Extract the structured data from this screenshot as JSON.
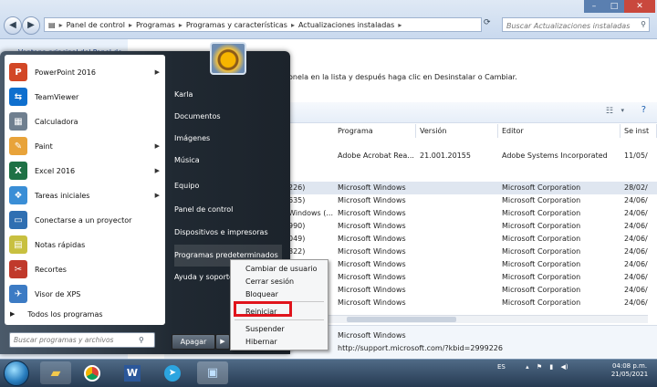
{
  "explorer": {
    "breadcrumbs": [
      "Panel de control",
      "Programas",
      "Programas y características",
      "Actualizaciones instaladas"
    ],
    "search_placeholder": "Buscar Actualizaciones instaladas",
    "left_pane_link_line1": "Ventana principal del Panel de",
    "instruction": "onela en la lista y después haga clic en Desinstalar o Cambiar.",
    "columns": [
      "Programa",
      "Versión",
      "Editor",
      "Se inst"
    ],
    "rows": [
      {
        "name": "",
        "program": "Adobe Acrobat Rea...",
        "version": "21.001.20155",
        "publisher": "Adobe Systems Incorporated",
        "date": "11/05/"
      },
      {
        "name": "226)",
        "program": "Microsoft Windows",
        "version": "",
        "publisher": "Microsoft Corporation",
        "date": "28/02/"
      },
      {
        "name": "635)",
        "program": "Microsoft Windows",
        "version": "",
        "publisher": "Microsoft Corporation",
        "date": "24/06/"
      },
      {
        "name": "Windows (...",
        "program": "Microsoft Windows",
        "version": "",
        "publisher": "Microsoft Corporation",
        "date": "24/06/"
      },
      {
        "name": "990)",
        "program": "Microsoft Windows",
        "version": "",
        "publisher": "Microsoft Corporation",
        "date": "24/06/"
      },
      {
        "name": "049)",
        "program": "Microsoft Windows",
        "version": "",
        "publisher": "Microsoft Corporation",
        "date": "24/06/"
      },
      {
        "name": "822)",
        "program": "Microsoft Windows",
        "version": "",
        "publisher": "Microsoft Corporation",
        "date": "24/06/"
      },
      {
        "name": "",
        "program": "Microsoft Windows",
        "version": "",
        "publisher": "Microsoft Corporation",
        "date": "24/06/"
      },
      {
        "name": "",
        "program": "Microsoft Windows",
        "version": "",
        "publisher": "Microsoft Corporation",
        "date": "24/06/"
      },
      {
        "name": "",
        "program": "Microsoft Windows",
        "version": "",
        "publisher": "Microsoft Corporation",
        "date": "24/06/"
      },
      {
        "name": "",
        "program": "Microsoft Windows",
        "version": "",
        "publisher": "Microsoft Corporation",
        "date": "24/06/"
      }
    ],
    "detail_line1": "Microsoft Windows",
    "detail_line2": "http://support.microsoft.com/?kbid=2999226"
  },
  "start_menu": {
    "programs": [
      {
        "label": "PowerPoint 2016",
        "icon": "powerpoint-icon",
        "color": "#d24726",
        "glyph": "P",
        "submenu": true
      },
      {
        "label": "TeamViewer",
        "icon": "teamviewer-icon",
        "color": "#0e6fce",
        "glyph": "⇆",
        "submenu": false
      },
      {
        "label": "Calculadora",
        "icon": "calculator-icon",
        "color": "#6f7f8f",
        "glyph": "▦",
        "submenu": false
      },
      {
        "label": "Paint",
        "icon": "paint-icon",
        "color": "#e8a33a",
        "glyph": "✎",
        "submenu": true
      },
      {
        "label": "Excel 2016",
        "icon": "excel-icon",
        "color": "#1e7145",
        "glyph": "X",
        "submenu": true
      },
      {
        "label": "Tareas iniciales",
        "icon": "getting-started-icon",
        "color": "#3a8ed6",
        "glyph": "❖",
        "submenu": true
      },
      {
        "label": "Conectarse a un proyector",
        "icon": "projector-icon",
        "color": "#2f6fb2",
        "glyph": "▭",
        "submenu": false
      },
      {
        "label": "Notas rápidas",
        "icon": "sticky-notes-icon",
        "color": "#c8c040",
        "glyph": "▤",
        "submenu": false
      },
      {
        "label": "Recortes",
        "icon": "snipping-tool-icon",
        "color": "#c0392b",
        "glyph": "✂",
        "submenu": false
      },
      {
        "label": "Visor de XPS",
        "icon": "xps-viewer-icon",
        "color": "#3c7bc4",
        "glyph": "✈",
        "submenu": false
      }
    ],
    "all_programs": "Todos los programas",
    "search_placeholder": "Buscar programas y archivos",
    "right_items": [
      "Karla",
      "Documentos",
      "Imágenes",
      "Música",
      "Equipo",
      "Panel de control",
      "Dispositivos e impresoras",
      "Programas predeterminados",
      "Ayuda y soporte"
    ],
    "shutdown_label": "Apagar",
    "power_submenu": [
      "Cambiar de usuario",
      "Cerrar sesión",
      "Bloquear",
      "Reiniciar",
      "Suspender",
      "Hibernar"
    ],
    "highlight_color": "#e0141c"
  },
  "taskbar": {
    "apps": [
      "explorer-icon",
      "chrome-icon",
      "word-icon",
      "telegram-icon",
      "control-panel-icon"
    ],
    "language": "ES",
    "time": "04:08 p.m.",
    "date": "21/05/2021"
  }
}
